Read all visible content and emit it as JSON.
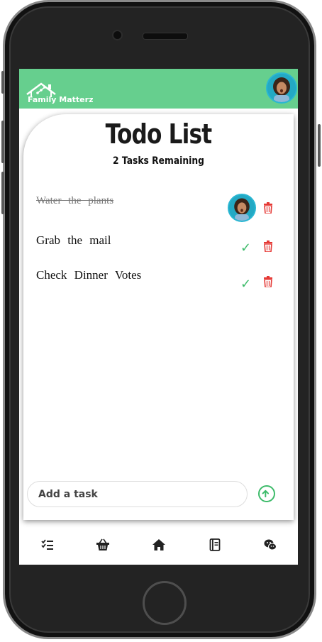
{
  "app": {
    "brand": "Family Matterz"
  },
  "main": {
    "title": "Todo List",
    "remaining": "2 Tasks Remaining"
  },
  "tasks": [
    {
      "label": "Water the plants",
      "completed": true
    },
    {
      "label": "Grab the mail",
      "completed": false
    },
    {
      "label": "Check Dinner Votes",
      "completed": false
    }
  ],
  "add_task": {
    "placeholder": "Add a task"
  },
  "nav": {
    "items": [
      {
        "icon": "checklist-icon"
      },
      {
        "icon": "basket-icon"
      },
      {
        "icon": "home-icon"
      },
      {
        "icon": "notebook-icon"
      },
      {
        "icon": "chat-icon"
      }
    ]
  },
  "colors": {
    "header": "#66cf8e",
    "accent_green": "#3dbb6a",
    "delete_red": "#e53935"
  }
}
